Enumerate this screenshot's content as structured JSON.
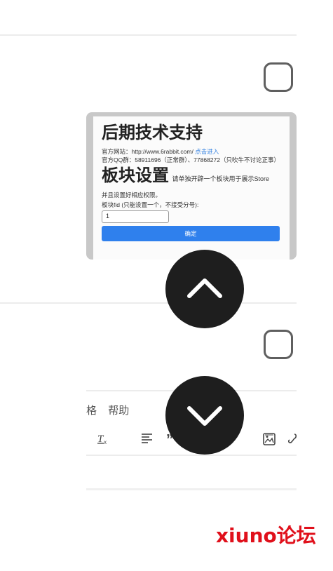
{
  "thumbnail": {
    "heading": "后期技术支持",
    "website_label": "官方网站：http://www.6rabbit.com/",
    "website_link": "点击进入",
    "qq_line": "官方QQ群：58911696（正常群）、77868272（只吹牛不讨论正事）",
    "section_title": "板块设置",
    "section_desc": "请单独开辟一个板块用于展示Store",
    "permission_note": "并且设置好相应权限。",
    "fid_label": "板块fid (只能设置一个，不接受分号):",
    "fid_value": "1",
    "confirm_label": "确定"
  },
  "editor_toolbar": {
    "menu_items": [
      "格",
      "帮助"
    ],
    "tools": [
      "clear-format-icon",
      "align-icon",
      "quote-icon",
      "image-icon",
      "link-icon"
    ]
  },
  "watermark": "xiuno论坛"
}
